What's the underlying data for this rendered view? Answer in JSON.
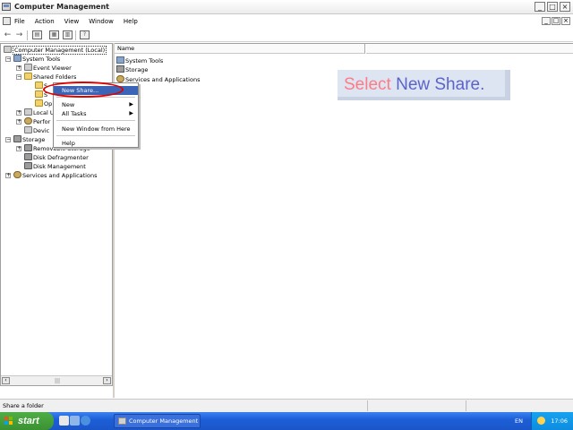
{
  "window": {
    "title": "Computer Management",
    "controls": [
      "_",
      "□",
      "×"
    ]
  },
  "menubar": {
    "items": [
      "File",
      "Action",
      "View",
      "Window",
      "Help"
    ]
  },
  "tree": {
    "items": [
      {
        "label": "Computer Management (Local)",
        "expander": ""
      },
      {
        "label": "System Tools",
        "expander": "−"
      },
      {
        "label": "Event Viewer",
        "expander": "+"
      },
      {
        "label": "Shared Folders",
        "expander": "−"
      },
      {
        "label": "Local U",
        "expander": "+"
      },
      {
        "label": "Perfor",
        "expander": "+"
      },
      {
        "label": "Devic",
        "expander": ""
      },
      {
        "label": "Storage",
        "expander": "−"
      },
      {
        "label": "Removable Storage",
        "expander": "+"
      },
      {
        "label": "Disk Defragmenter",
        "expander": ""
      },
      {
        "label": "Disk Management",
        "expander": ""
      },
      {
        "label": "Services and Applications",
        "expander": "+"
      }
    ],
    "partial_children": [
      "S",
      "S",
      "Op"
    ]
  },
  "list": {
    "column_header": "Name",
    "items": [
      "System Tools",
      "Storage",
      "Services and Applications"
    ]
  },
  "context_menu": {
    "items": [
      {
        "label": "New Share...",
        "submenu": false
      },
      {
        "label": "New",
        "submenu": true
      },
      {
        "label": "All Tasks",
        "submenu": true
      },
      {
        "label": "New Window from Here",
        "submenu": false
      },
      {
        "label": "Help",
        "submenu": false
      }
    ]
  },
  "callout": {
    "part1": "Select ",
    "part2": "New Share."
  },
  "status": {
    "text": "Share a folder"
  },
  "taskbar": {
    "start_label": "start",
    "task_label": "Computer Management",
    "lang": "EN",
    "clock": "17:06"
  },
  "colors": {
    "accent": "#3b63b6",
    "highlight_ring": "#e00000",
    "callout_pink": "#ff7b86",
    "callout_blue": "#5c63c9"
  }
}
